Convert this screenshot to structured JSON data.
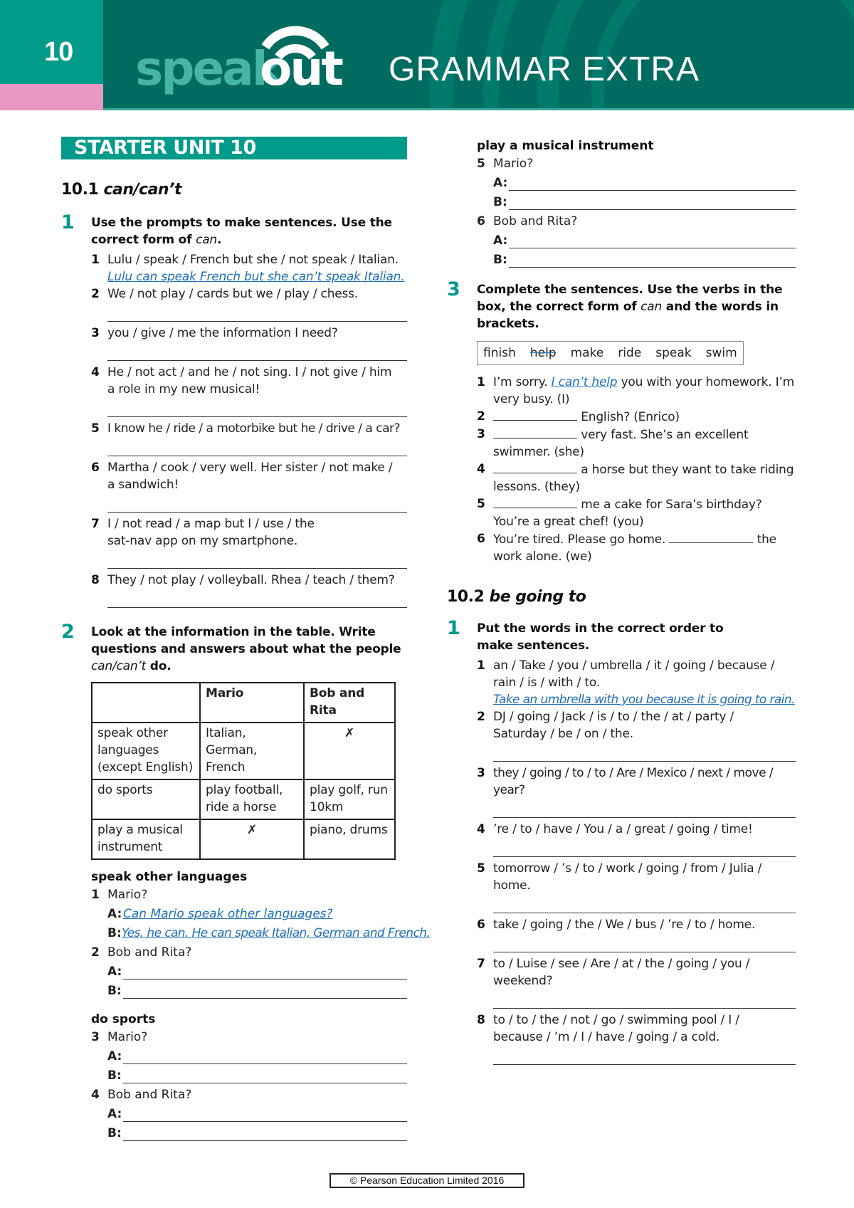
{
  "header": {
    "unit_number": "10",
    "logo_speak": "speak",
    "logo_out": "out",
    "title": "GRAMMAR EXTRA",
    "colors": {
      "teal": "#009b8a",
      "dark_teal": "#006b5f",
      "pink": "#e898c2",
      "logo_light": "#45b5a6",
      "answer_blue": "#1f6fb8"
    }
  },
  "banner": "STARTER UNIT 10",
  "s101": {
    "num": "10.1",
    "title": "can/can’t",
    "ex1": {
      "num": "1",
      "instr_a": "Use the prompts to make sentences. Use the correct form of ",
      "instr_em": "can",
      "instr_b": ".",
      "items": [
        {
          "n": "1",
          "text": "Lulu / speak / French but she / not speak / Italian.",
          "answer": "Lulu can speak French but she can’t speak Italian."
        },
        {
          "n": "2",
          "text": "We / not play / cards but we / play / chess."
        },
        {
          "n": "3",
          "text": "you / give / me the information I need?"
        },
        {
          "n": "4",
          "text": "He / not act / and he / not sing. I / not give / him a role in my new musical!"
        },
        {
          "n": "5",
          "text": "I know he / ride / a motorbike but he / drive / a car?"
        },
        {
          "n": "6",
          "text": "Martha / cook / very well. Her sister / not make / a sandwich!"
        },
        {
          "n": "7",
          "text": "I / not read / a map but I / use / the sat-nav app on my smartphone."
        },
        {
          "n": "8",
          "text": "They / not play / volleyball. Rhea / teach / them?"
        }
      ]
    },
    "ex2": {
      "num": "2",
      "instr_a": "Look at the information in the table. Write questions and answers about what the people ",
      "instr_em": "can/can’t",
      "instr_b": " do.",
      "table": {
        "headers": [
          "",
          "Mario",
          "Bob and Rita"
        ],
        "rows": [
          [
            "speak other languages (except English)",
            "Italian, German, French",
            "✗"
          ],
          [
            "do sports",
            "play football, ride a horse",
            "play golf, run 10km"
          ],
          [
            "play a musical instrument",
            "✗",
            "piano, drums"
          ]
        ]
      },
      "groups": [
        {
          "heading": "speak other languages",
          "qs": [
            {
              "n": "1",
              "who": "Mario?",
              "a": "Can Mario speak other languages?",
              "b": "Yes, he can. He can speak Italian, German and French."
            },
            {
              "n": "2",
              "who": "Bob and Rita?",
              "a": "",
              "b": ""
            }
          ]
        },
        {
          "heading": "do sports",
          "qs": [
            {
              "n": "3",
              "who": "Mario?",
              "a": "",
              "b": ""
            },
            {
              "n": "4",
              "who": "Bob and Rita?",
              "a": "",
              "b": ""
            }
          ]
        },
        {
          "heading": "play a musical instrument",
          "qs": [
            {
              "n": "5",
              "who": "Mario?",
              "a": "",
              "b": ""
            },
            {
              "n": "6",
              "who": "Bob and Rita?",
              "a": "",
              "b": ""
            }
          ]
        }
      ],
      "label_a": "A:",
      "label_b": "B:"
    },
    "ex3": {
      "num": "3",
      "instr_a": "Complete the sentences. Use the verbs in the box, the correct form of ",
      "instr_em": "can",
      "instr_b": " and the words in brackets.",
      "words": [
        "finish",
        "help",
        "make",
        "ride",
        "speak",
        "swim"
      ],
      "struck_word": "help",
      "items": [
        {
          "n": "1",
          "before": "I’m sorry. ",
          "answer": "I can’t help",
          "after": " you with your homework. I’m very busy. (I)"
        },
        {
          "n": "2",
          "before": "",
          "after": " English? (Enrico)"
        },
        {
          "n": "3",
          "before": "",
          "after": " very fast. She’s an excellent swimmer. (she)"
        },
        {
          "n": "4",
          "before": "",
          "after": " a horse but they want to take riding lessons. (they)"
        },
        {
          "n": "5",
          "before": "",
          "after": " me a cake for Sara’s birthday? You’re a great chef! (you)"
        },
        {
          "n": "6",
          "before": "You’re tired. Please go home. ",
          "after": " the work alone. (we)"
        }
      ]
    }
  },
  "s102": {
    "num": "10.2",
    "title": "be going to",
    "ex1": {
      "num": "1",
      "instr": "Put the words in the correct order to make sentences.",
      "items": [
        {
          "n": "1",
          "text": "an / Take / you / umbrella / it / going / because / rain / is / with / to.",
          "answer": "Take an umbrella with you because it is going to rain."
        },
        {
          "n": "2",
          "text": "DJ / going / Jack / is / to / the / at / party / Saturday / be / on / the."
        },
        {
          "n": "3",
          "text": "they / going / to / to / Are / Mexico / next / move / year?"
        },
        {
          "n": "4",
          "text": "’re / to / have / You / a / great / going / time!"
        },
        {
          "n": "5",
          "text": "tomorrow / ’s / to / work / going / from / Julia / home."
        },
        {
          "n": "6",
          "text": "take / going / the / We / bus / ’re / to / home."
        },
        {
          "n": "7",
          "text": "to / Luise / see / Are / at / the / going / you / weekend?"
        },
        {
          "n": "8",
          "text": "to / to / the / not / go / swimming pool / I / because / ’m / I / have / going / a cold."
        }
      ]
    }
  },
  "footer": "© Pearson Education Limited 2016"
}
